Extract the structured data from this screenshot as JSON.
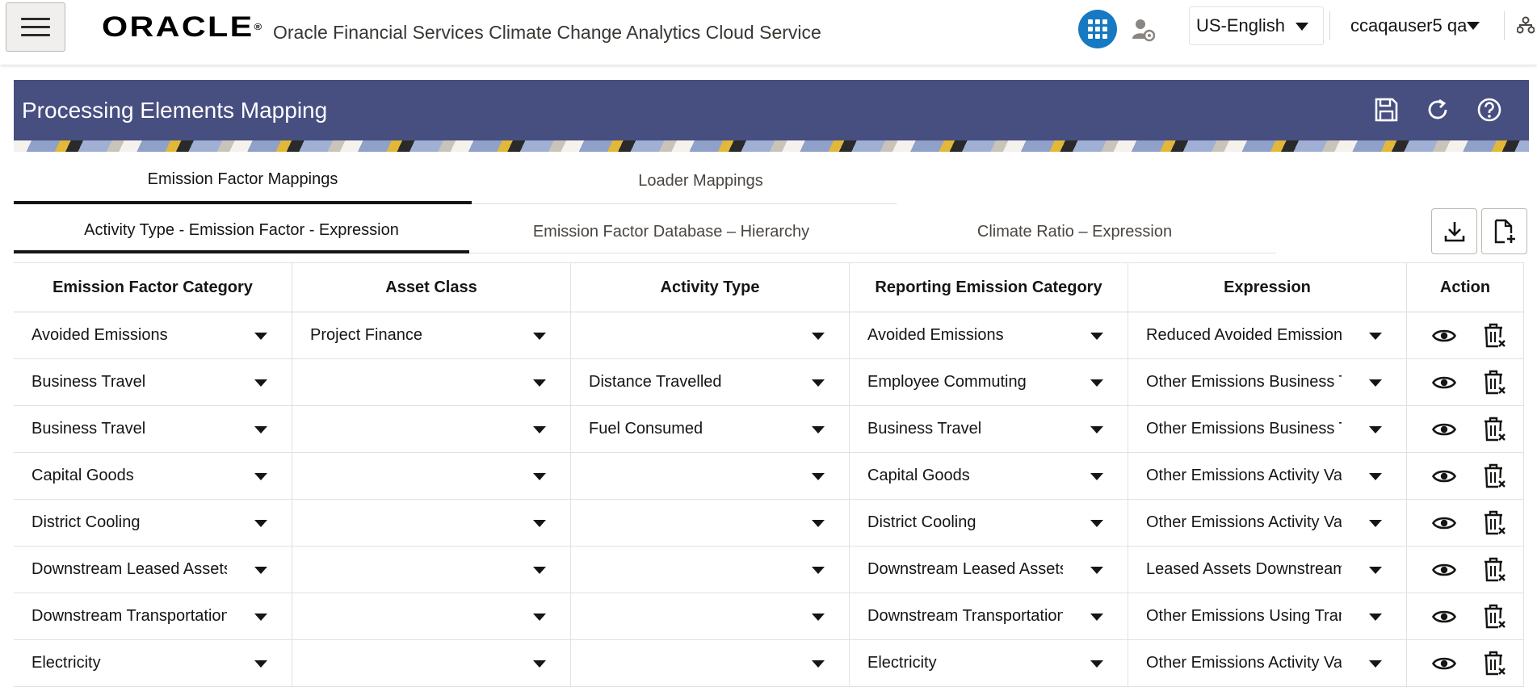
{
  "header": {
    "logo_text": "ORACLE",
    "logo_mark": "®",
    "app_title": "Oracle Financial Services Climate Change Analytics Cloud Service",
    "apps_icon": "apps-grid-icon",
    "language": "US-English",
    "user": "ccaqauser5 qa",
    "accent_color": "#1679c2"
  },
  "page": {
    "title": "Processing Elements Mapping",
    "banner_color": "#474e80"
  },
  "tabs_primary": [
    {
      "label": "Emission Factor Mappings",
      "active": true
    },
    {
      "label": "Loader Mappings",
      "active": false
    }
  ],
  "tabs_secondary": [
    {
      "label": "Activity Type - Emission Factor - Expression",
      "active": true
    },
    {
      "label": "Emission Factor Database – Hierarchy",
      "active": false
    },
    {
      "label": "Climate Ratio – Expression",
      "active": false
    }
  ],
  "table": {
    "columns": [
      "Emission Factor Category",
      "Asset Class",
      "Activity Type",
      "Reporting Emission Category",
      "Expression",
      "Action"
    ],
    "rows": [
      [
        "Avoided Emissions",
        "Project Finance",
        "",
        "Avoided Emissions",
        "Reduced Avoided Emissions"
      ],
      [
        "Business Travel",
        "",
        "Distance Travelled",
        "Employee Commuting",
        "Other Emissions Business Tra"
      ],
      [
        "Business Travel",
        "",
        "Fuel Consumed",
        "Business Travel",
        "Other Emissions Business Tra"
      ],
      [
        "Capital Goods",
        "",
        "",
        "Capital Goods",
        "Other Emissions Activity Valu"
      ],
      [
        "District Cooling",
        "",
        "",
        "District Cooling",
        "Other Emissions Activity Valu"
      ],
      [
        "Downstream Leased Assets",
        "",
        "",
        "Downstream Leased Assets",
        "Leased Assets Downstream"
      ],
      [
        "Downstream Transportation",
        "",
        "",
        "Downstream Transportation",
        "Other Emissions Using Trans"
      ],
      [
        "Electricity",
        "",
        "",
        "Electricity",
        "Other Emissions Activity Valu"
      ]
    ]
  }
}
